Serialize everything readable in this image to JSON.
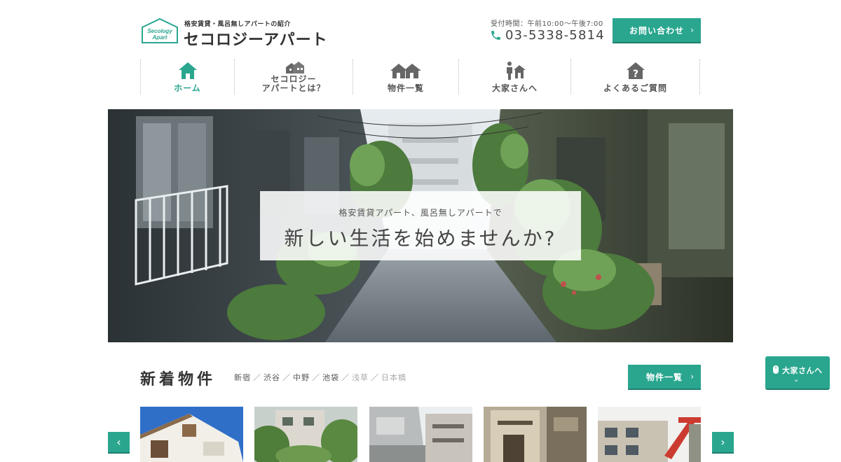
{
  "colors": {
    "accent": "#2aa68f",
    "accent_dark": "#1d7e6d",
    "text": "#444444",
    "muted": "#aaaaaa"
  },
  "header": {
    "logo_badge_line1": "Secology",
    "logo_badge_line2": "Apart",
    "tagline": "格安賃貸・風呂無しアパートの紹介",
    "site_name": "セコロジーアパート",
    "hours": "受付時間：午前10:00～午後7:00",
    "phone": "03-5338-5814",
    "phone_icon": "phone-icon",
    "contact_label": "お問い合わせ",
    "contact_chevron": "›"
  },
  "nav": {
    "items": [
      {
        "label": "ホーム",
        "icon": "home-icon",
        "active": true
      },
      {
        "label": "セコロジー\nアパートとは？",
        "icon": "houses-cluster-icon",
        "active": false
      },
      {
        "label": "物件一覧",
        "icon": "two-houses-icon",
        "active": false
      },
      {
        "label": "大家さんへ",
        "icon": "people-house-icon",
        "active": false
      },
      {
        "label": "よくあるご質問",
        "icon": "question-house-icon",
        "active": false
      }
    ]
  },
  "hero": {
    "subtitle": "格安賃貸アパート、風呂無しアパートで",
    "title": "新しい生活を始めませんか?"
  },
  "listings": {
    "title": "新着物件",
    "areas": [
      {
        "name": "新宿",
        "muted": false
      },
      {
        "name": "渋谷",
        "muted": false
      },
      {
        "name": "中野",
        "muted": false
      },
      {
        "name": "池袋",
        "muted": false
      },
      {
        "name": "浅草",
        "muted": true
      },
      {
        "name": "日本橋",
        "muted": true
      }
    ],
    "separator": "／",
    "list_button": "物件一覧",
    "list_chevron": "›",
    "prev_arrow": "‹",
    "next_arrow": "›",
    "thumbnails": 5
  },
  "floating": {
    "label": "大家さんへ",
    "icon": "mouse-icon",
    "chevron": "⌄"
  }
}
